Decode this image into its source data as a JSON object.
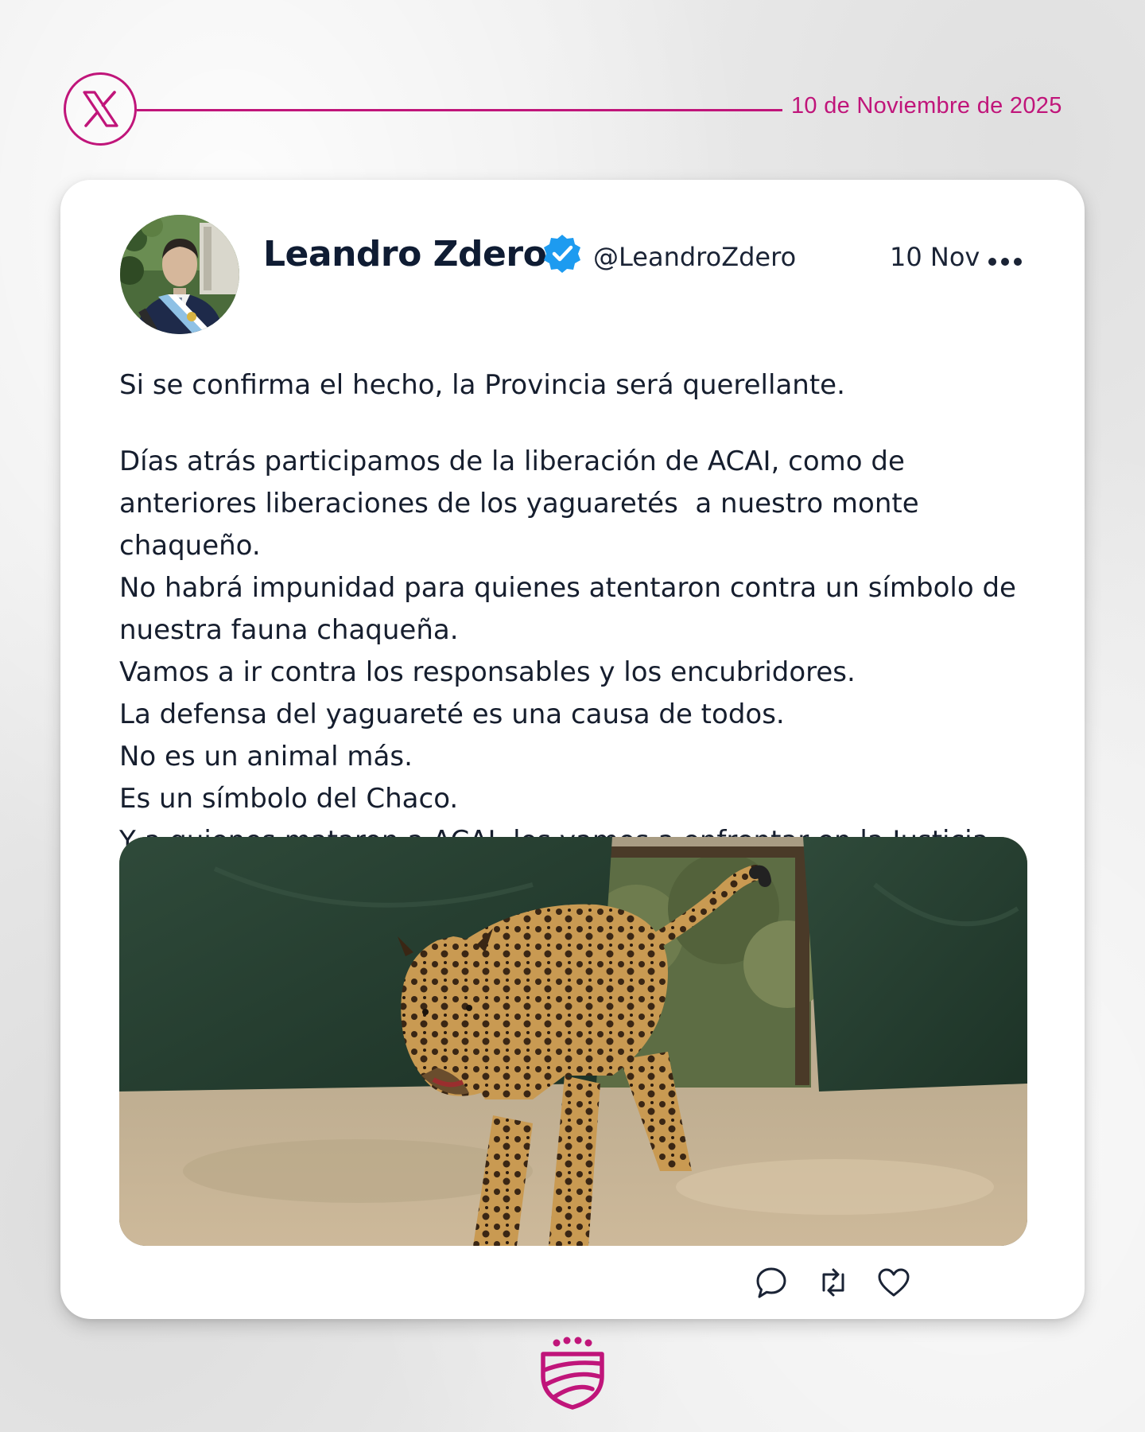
{
  "header": {
    "platform_icon": "x-logo-icon",
    "date": "10 de Noviembre de 2025",
    "accent_color": "#c0157a"
  },
  "post": {
    "author_name": "Leandro Zdero",
    "verified_icon": "verified-badge-icon",
    "handle": "@LeandroZdero",
    "date": "10 Nov",
    "more_icon": "more-dots-icon",
    "paragraphs": [
      "Si se confirma el hecho, la Provincia será querellante.",
      "Días atrás participamos de la liberación de ACAI, como de anteriores liberaciones de los yaguaretés  a nuestro monte chaqueño.",
      "No habrá impunidad para quienes atentaron contra un símbolo de nuestra fauna chaqueña.",
      "Vamos a ir contra los responsables y los encubridores.",
      "La defensa del yaguareté es una causa de todos.",
      "No es un animal más.",
      "Es un símbolo del Chaco.",
      "Y a quienes mataron a ACAI, los vamos a enfrentar en la Justicia."
    ],
    "media_description": "jaguar-photo",
    "actions": [
      "reply-icon",
      "retweet-icon",
      "like-icon"
    ]
  },
  "footer": {
    "logo_icon": "chaco-government-logo-icon"
  }
}
